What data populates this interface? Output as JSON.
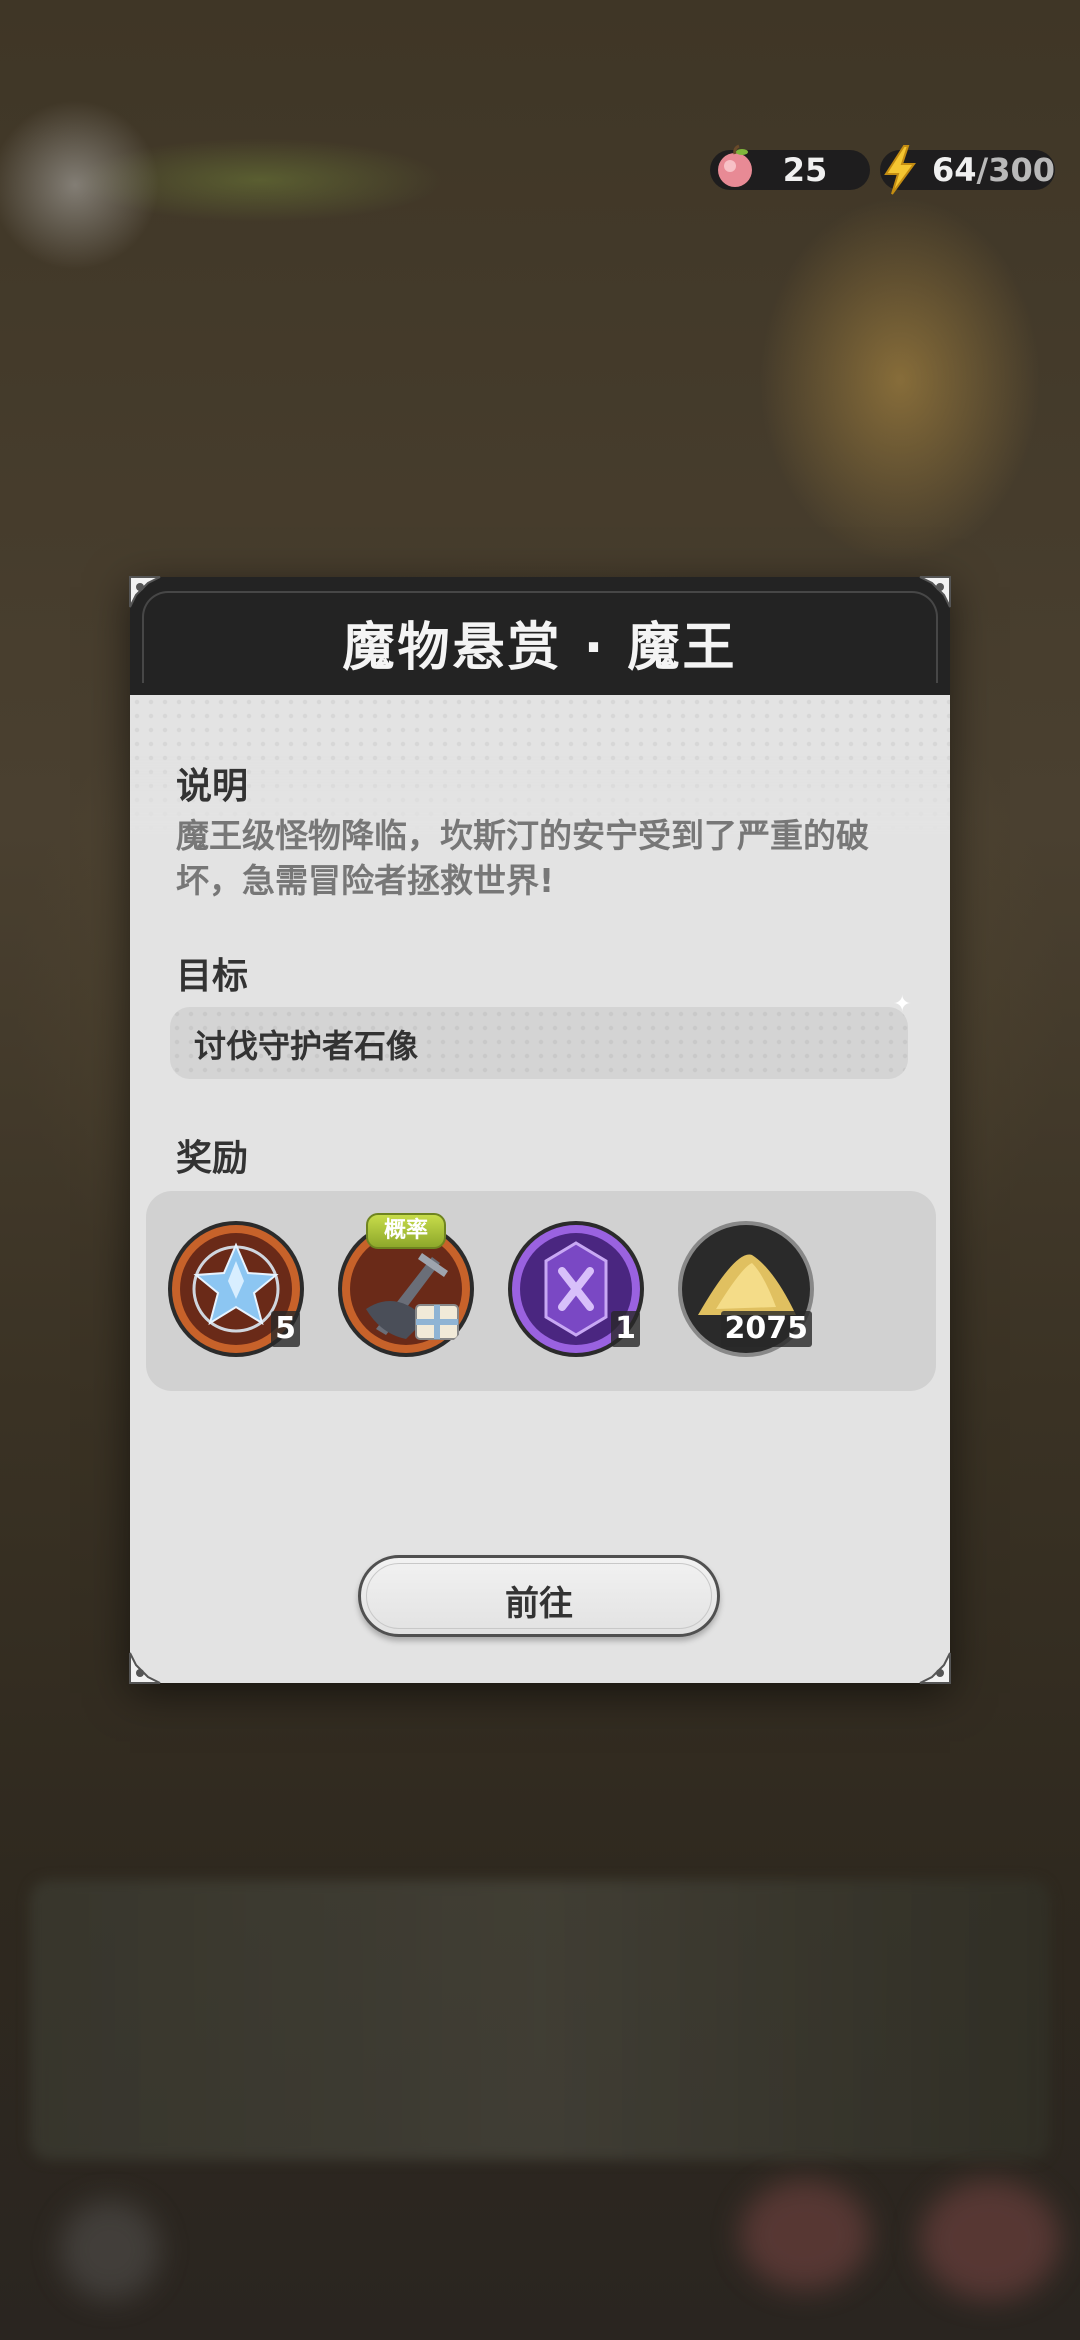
{
  "resources": {
    "apple_value": "25",
    "energy_value": "64",
    "energy_max": "/300"
  },
  "modal": {
    "title": "魔物悬赏 · 魔王",
    "description_label": "说明",
    "description_line1": "魔王级怪物降临，坎斯汀的安宁受到了严重的破",
    "description_line2": "坏，急需冒险者拯救世界!",
    "target_label": "目标",
    "target_text": "讨伐守护者石像",
    "reward_label": "奖励",
    "rewards": [
      {
        "icon": "blue-crystal-icon",
        "count": "5"
      },
      {
        "icon": "sword-gift-icon",
        "badge": "概率"
      },
      {
        "icon": "purple-gem-icon",
        "count": "1"
      },
      {
        "icon": "gold-pile-icon",
        "count": "2075"
      }
    ],
    "go_button": "前往"
  },
  "colors": {
    "header_bg": "#232323",
    "body_bg": "#e3e3e3",
    "text_dark": "#333333",
    "text_muted": "#777777",
    "badge_green": "#a5c23a"
  }
}
